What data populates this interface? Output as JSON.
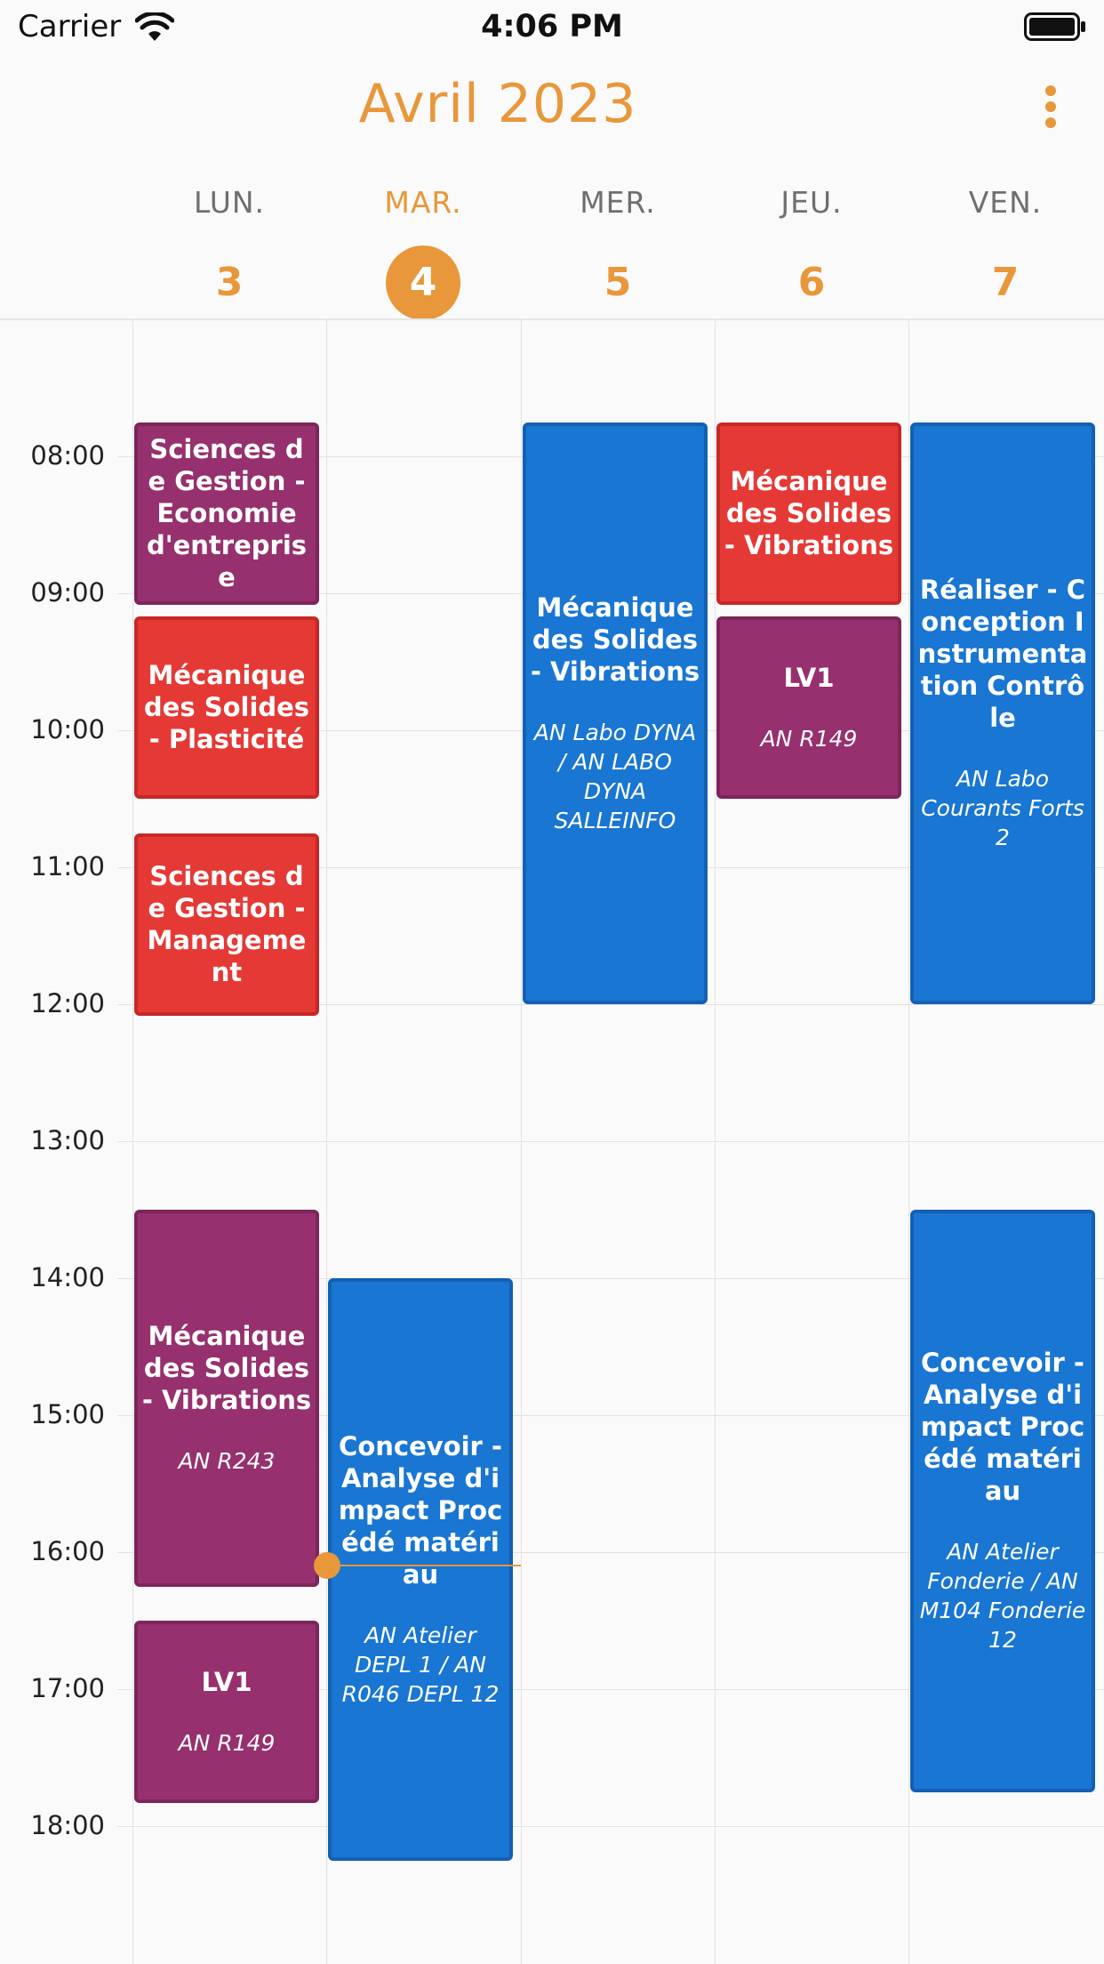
{
  "status_bar": {
    "carrier": "Carrier",
    "time": "4:06 PM"
  },
  "header": {
    "title": "Avril 2023",
    "more_icon": "more-vertical-icon"
  },
  "days": [
    {
      "name": "LUN.",
      "number": "3"
    },
    {
      "name": "MAR.",
      "number": "4",
      "today": true
    },
    {
      "name": "MER.",
      "number": "5"
    },
    {
      "name": "JEU.",
      "number": "6"
    },
    {
      "name": "VEN.",
      "number": "7"
    }
  ],
  "hours": [
    "08:00",
    "09:00",
    "10:00",
    "11:00",
    "12:00",
    "13:00",
    "14:00",
    "15:00",
    "16:00",
    "17:00",
    "18:00"
  ],
  "current_time_indicator": {
    "day": "MAR.",
    "time": "4:06 PM"
  },
  "events": [
    {
      "day": "LUN.",
      "start": "07:45",
      "end": "09:05",
      "title": "Sciences de Gestion - Economie d'entreprise",
      "room": "",
      "color": "#96306e"
    },
    {
      "day": "LUN.",
      "start": "09:10",
      "end": "10:30",
      "title": "Mécanique des Solides - Plasticité",
      "room": "",
      "color": "#e53935"
    },
    {
      "day": "LUN.",
      "start": "10:45",
      "end": "12:05",
      "title": "Sciences de Gestion - Management",
      "room": "",
      "color": "#e53935"
    },
    {
      "day": "LUN.",
      "start": "13:30",
      "end": "16:15",
      "title": "Mécanique des Solides - Vibrations",
      "room": "AN R243",
      "color": "#96306e"
    },
    {
      "day": "LUN.",
      "start": "16:30",
      "end": "17:50",
      "title": "LV1",
      "room": "AN R149",
      "color": "#96306e"
    },
    {
      "day": "MAR.",
      "start": "14:00",
      "end": "18:15",
      "title": "Concevoir - Analyse d'impact Procédé matériau",
      "room": "AN Atelier DEPL 1 / AN R046 DEPL 12",
      "color": "#1976d2"
    },
    {
      "day": "MER.",
      "start": "07:45",
      "end": "12:00",
      "title": "Mécanique des Solides - Vibrations",
      "room": "AN Labo DYNA / AN LABO DYNA SALLEINFO",
      "color": "#1976d2"
    },
    {
      "day": "JEU.",
      "start": "07:45",
      "end": "09:05",
      "title": "Mécanique des Solides - Vibrations",
      "room": "",
      "color": "#e53935"
    },
    {
      "day": "JEU.",
      "start": "09:10",
      "end": "10:30",
      "title": "LV1",
      "room": "AN R149",
      "color": "#96306e"
    },
    {
      "day": "VEN.",
      "start": "07:45",
      "end": "12:00",
      "title": "Réaliser - Conception Instrumentation Contrôle",
      "room": "AN Labo Courants Forts 2",
      "color": "#1976d2"
    },
    {
      "day": "VEN.",
      "start": "13:30",
      "end": "17:45",
      "title": "Concevoir - Analyse d'impact Procédé matériau",
      "room": "AN Atelier Fonderie / AN M104 Fonderie 12",
      "color": "#1976d2"
    }
  ]
}
